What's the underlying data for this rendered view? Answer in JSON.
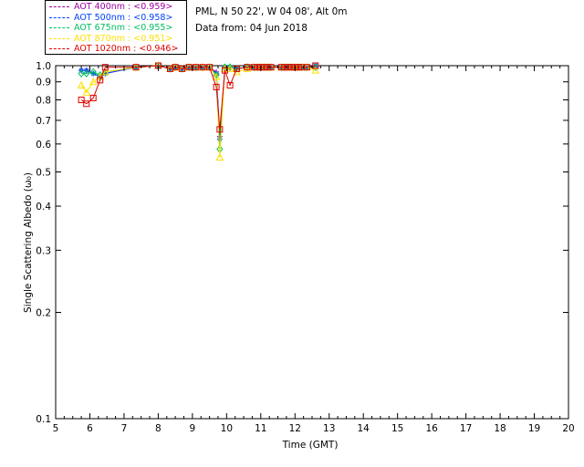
{
  "header": {
    "site": "PML, N 50 22', W 04 08', Alt 0m",
    "date": "Data from: 04 Jun 2018"
  },
  "legend": [
    {
      "text": "AOT  400nm : <0.959>",
      "color": "#a000a0"
    },
    {
      "text": "AOT  500nm : <0.958>",
      "color": "#0040ff"
    },
    {
      "text": "AOT  675nm : <0.955>",
      "color": "#00c060"
    },
    {
      "text": "AOT  870nm : <0.951>",
      "color": "#ffe000"
    },
    {
      "text": "AOT 1020nm : <0.946>",
      "color": "#e00000"
    }
  ],
  "chart_data": {
    "type": "scatter",
    "xlabel": "Time (GMT)",
    "ylabel": "Single Scattering Albedo (ω₀)",
    "xlim": [
      5,
      20
    ],
    "ylim": [
      0.1,
      1.0
    ],
    "yscale": "log",
    "xticks": [
      "5",
      "6",
      "7",
      "8",
      "9",
      "10",
      "11",
      "12",
      "13",
      "14",
      "15",
      "16",
      "17",
      "18",
      "19",
      "20"
    ],
    "yticks": [
      {
        "v": 1.0,
        "label": "1.0"
      },
      {
        "v": 0.9,
        "label": "0.9"
      },
      {
        "v": 0.8,
        "label": "0.8"
      },
      {
        "v": 0.7,
        "label": "0.7"
      },
      {
        "v": 0.6,
        "label": "0.6"
      },
      {
        "v": 0.5,
        "label": "0.5"
      },
      {
        "v": 0.4,
        "label": "0.4"
      },
      {
        "v": 0.3,
        "label": "0.3"
      },
      {
        "v": 0.2,
        "label": "0.2"
      },
      {
        "v": 0.1,
        "label": "0.1"
      }
    ],
    "x": [
      5.75,
      5.9,
      6.1,
      6.3,
      6.45,
      7.35,
      8.0,
      8.35,
      8.5,
      8.7,
      8.9,
      9.1,
      9.3,
      9.5,
      9.7,
      9.8,
      9.95,
      10.1,
      10.3,
      10.6,
      10.8,
      10.9,
      11.0,
      11.1,
      11.2,
      11.3,
      11.6,
      11.7,
      11.8,
      11.9,
      12.0,
      12.1,
      12.2,
      12.35,
      12.6
    ],
    "series": [
      {
        "name": "AOT  400nm : <0.959>",
        "color": "#a000a0",
        "marker": "plus",
        "values": [
          0.97,
          0.97,
          0.95,
          0.93,
          0.95,
          0.99,
          1.0,
          0.98,
          0.99,
          0.98,
          0.99,
          0.99,
          0.99,
          0.99,
          0.96,
          0.63,
          0.99,
          0.99,
          0.98,
          0.99,
          0.99,
          0.99,
          0.99,
          0.99,
          0.99,
          0.99,
          0.99,
          0.99,
          0.99,
          0.99,
          0.99,
          0.99,
          0.99,
          0.99,
          1.0
        ]
      },
      {
        "name": "AOT  500nm : <0.958>",
        "color": "#0040ff",
        "marker": "star",
        "values": [
          0.97,
          0.97,
          0.95,
          0.93,
          0.95,
          0.99,
          1.0,
          0.98,
          0.99,
          0.98,
          0.99,
          0.99,
          0.99,
          0.99,
          0.95,
          0.62,
          0.99,
          0.99,
          0.98,
          0.99,
          0.99,
          0.99,
          0.99,
          0.99,
          0.99,
          0.99,
          0.99,
          0.99,
          0.99,
          0.99,
          0.99,
          0.99,
          0.99,
          0.99,
          1.0
        ]
      },
      {
        "name": "AOT  675nm : <0.955>",
        "color": "#00c060",
        "marker": "diamond",
        "values": [
          0.95,
          0.95,
          0.96,
          0.94,
          0.96,
          0.99,
          1.0,
          0.98,
          0.99,
          0.98,
          0.99,
          0.99,
          0.99,
          0.99,
          0.94,
          0.58,
          0.99,
          0.99,
          0.98,
          0.99,
          0.99,
          0.99,
          0.99,
          0.99,
          0.99,
          0.99,
          0.99,
          0.99,
          0.99,
          0.99,
          0.99,
          0.99,
          0.99,
          0.99,
          0.99
        ]
      },
      {
        "name": "AOT  870nm : <0.951>",
        "color": "#ffe000",
        "marker": "triangle",
        "values": [
          0.88,
          0.84,
          0.9,
          0.93,
          0.96,
          0.99,
          1.0,
          0.98,
          0.99,
          0.98,
          0.99,
          0.99,
          0.99,
          0.99,
          0.93,
          0.55,
          0.98,
          0.98,
          0.96,
          0.98,
          0.99,
          0.99,
          0.99,
          0.99,
          0.99,
          0.99,
          0.99,
          0.99,
          0.99,
          0.99,
          0.99,
          0.99,
          0.99,
          0.99,
          0.97
        ]
      },
      {
        "name": "AOT 1020nm : <0.946>",
        "color": "#e00000",
        "marker": "square",
        "values": [
          0.8,
          0.78,
          0.81,
          0.91,
          0.99,
          0.99,
          1.0,
          0.98,
          0.99,
          0.98,
          0.99,
          0.99,
          0.99,
          0.99,
          0.87,
          0.66,
          0.97,
          0.88,
          0.98,
          0.99,
          0.99,
          0.99,
          0.99,
          0.99,
          0.99,
          0.99,
          0.99,
          0.99,
          0.99,
          0.99,
          0.99,
          0.99,
          0.99,
          0.99,
          1.0
        ]
      }
    ]
  }
}
